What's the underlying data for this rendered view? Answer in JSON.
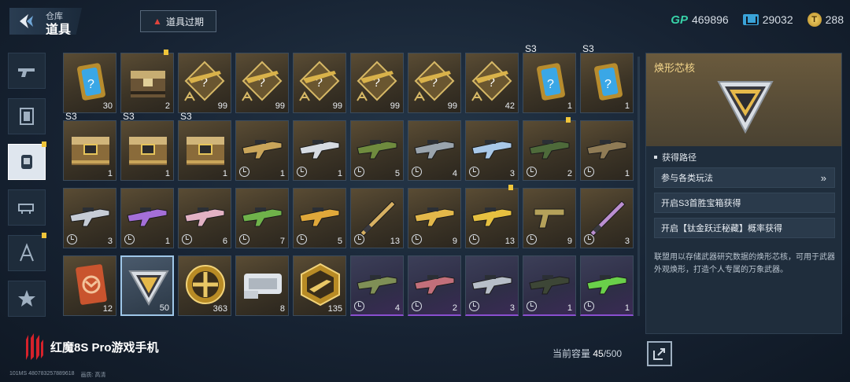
{
  "header": {
    "breadcrumb_small": "仓库",
    "breadcrumb_big": "道具",
    "expire_button": "道具过期",
    "currencies": [
      {
        "icon": "gp-icon",
        "label": "GP",
        "value": "469896"
      },
      {
        "icon": "ticket-icon",
        "value": "29032"
      },
      {
        "icon": "coin-icon",
        "symbol": "T",
        "value": "288"
      }
    ]
  },
  "sidebar": {
    "tabs": [
      {
        "name": "pistol-tab",
        "active": false,
        "badge": false
      },
      {
        "name": "card-tab",
        "active": false,
        "badge": false
      },
      {
        "name": "item-tab",
        "active": true,
        "badge": true
      },
      {
        "name": "vehicle-tab",
        "active": false,
        "badge": false
      },
      {
        "name": "blueprint-tab",
        "active": false,
        "badge": true
      },
      {
        "name": "emblem-tab",
        "active": false,
        "badge": false
      }
    ]
  },
  "items": [
    {
      "type": "card",
      "count": "30",
      "tier": "gold"
    },
    {
      "type": "crate",
      "count": "2",
      "tier": "gold",
      "badge": true
    },
    {
      "type": "blueprint",
      "count": "99",
      "tier": "gold"
    },
    {
      "type": "blueprint",
      "count": "99",
      "tier": "gold"
    },
    {
      "type": "blueprint",
      "count": "99",
      "tier": "gold"
    },
    {
      "type": "blueprint",
      "count": "99",
      "tier": "gold"
    },
    {
      "type": "blueprint",
      "count": "99",
      "tier": "gold"
    },
    {
      "type": "blueprint",
      "count": "42",
      "tier": "gold"
    },
    {
      "type": "card",
      "count": "1",
      "tier": "gold",
      "label": "S3"
    },
    {
      "type": "card",
      "count": "1",
      "tier": "gold",
      "label": "S3"
    },
    {
      "type": "chest",
      "count": "1",
      "tier": "gold",
      "label": "S3"
    },
    {
      "type": "chest",
      "count": "1",
      "tier": "gold",
      "label": "S3"
    },
    {
      "type": "chest",
      "count": "1",
      "tier": "gold",
      "label": "S3"
    },
    {
      "type": "gun",
      "count": "1",
      "tier": "gold",
      "clock": true,
      "color": "#c9a55a"
    },
    {
      "type": "gun",
      "count": "1",
      "tier": "gold",
      "clock": true,
      "color": "#d6dbe2"
    },
    {
      "type": "gun",
      "count": "5",
      "tier": "gold",
      "clock": true,
      "color": "#6f8b3e"
    },
    {
      "type": "gun",
      "count": "4",
      "tier": "gold",
      "clock": true,
      "color": "#9aa4ad"
    },
    {
      "type": "gun",
      "count": "3",
      "tier": "gold",
      "clock": true,
      "color": "#a9c8e8"
    },
    {
      "type": "gun",
      "count": "2",
      "tier": "gold",
      "clock": true,
      "color": "#4e6a3a",
      "badge": true
    },
    {
      "type": "gun",
      "count": "1",
      "tier": "gold",
      "clock": true,
      "color": "#8f7b55"
    },
    {
      "type": "gun",
      "count": "3",
      "tier": "gold",
      "clock": true,
      "color": "#c6ccd6"
    },
    {
      "type": "gun",
      "count": "1",
      "tier": "gold",
      "clock": true,
      "color": "#a46fd8"
    },
    {
      "type": "gun",
      "count": "6",
      "tier": "gold",
      "clock": true,
      "color": "#e2b2c4"
    },
    {
      "type": "gun",
      "count": "7",
      "tier": "gold",
      "clock": true,
      "color": "#6fb24a"
    },
    {
      "type": "gun",
      "count": "5",
      "tier": "gold",
      "clock": true,
      "color": "#e0a83a"
    },
    {
      "type": "blade",
      "count": "13",
      "tier": "gold",
      "clock": true,
      "color": "#d7b062"
    },
    {
      "type": "gun",
      "count": "9",
      "tier": "gold",
      "clock": true,
      "color": "#e3b84a"
    },
    {
      "type": "gun",
      "count": "13",
      "tier": "gold",
      "clock": true,
      "color": "#e6c040",
      "badge": true
    },
    {
      "type": "pistol",
      "count": "9",
      "tier": "gold",
      "clock": true,
      "color": "#b4a15a"
    },
    {
      "type": "blade",
      "count": "3",
      "tier": "gold",
      "clock": true,
      "color": "#bb8fd0"
    },
    {
      "type": "orange-card",
      "count": "12",
      "tier": "gold"
    },
    {
      "type": "core",
      "count": "50",
      "tier": "blue",
      "selected": true
    },
    {
      "type": "medal",
      "count": "363",
      "tier": "gold"
    },
    {
      "type": "device",
      "count": "8",
      "tier": "gold"
    },
    {
      "type": "hex",
      "count": "135",
      "tier": "gold"
    },
    {
      "type": "gun",
      "count": "4",
      "tier": "purple",
      "clock": true,
      "color": "#7f8f56"
    },
    {
      "type": "gun",
      "count": "2",
      "tier": "purple",
      "clock": true,
      "color": "#c26f7a"
    },
    {
      "type": "gun",
      "count": "3",
      "tier": "purple",
      "clock": true,
      "color": "#b7bec8"
    },
    {
      "type": "gun",
      "count": "1",
      "tier": "purple",
      "clock": true,
      "color": "#3d4636"
    },
    {
      "type": "gun",
      "count": "1",
      "tier": "purple",
      "clock": true,
      "color": "#6ad04a"
    }
  ],
  "detail": {
    "title": "焕形芯核",
    "section_label": "获得路径",
    "routes": [
      {
        "label": "参与各类玩法",
        "has_arrow": true,
        "arrow": "»"
      },
      {
        "label": "开启S3首胜宝箱获得",
        "has_arrow": false
      },
      {
        "label": "开启【钛金跃迁秘藏】概率获得",
        "has_arrow": false
      }
    ],
    "description": "联盟用以存储武器研究数据的焕形芯核，可用于武器外观焕形，打造个人专属的万象武器。"
  },
  "footer": {
    "capacity_label": "当前容量",
    "capacity_current": "45",
    "capacity_max": "/500",
    "brand": "红魔8S Pro游戏手机",
    "small_id": "101MS  480783257889618",
    "small_quality": "画质: 高清"
  }
}
